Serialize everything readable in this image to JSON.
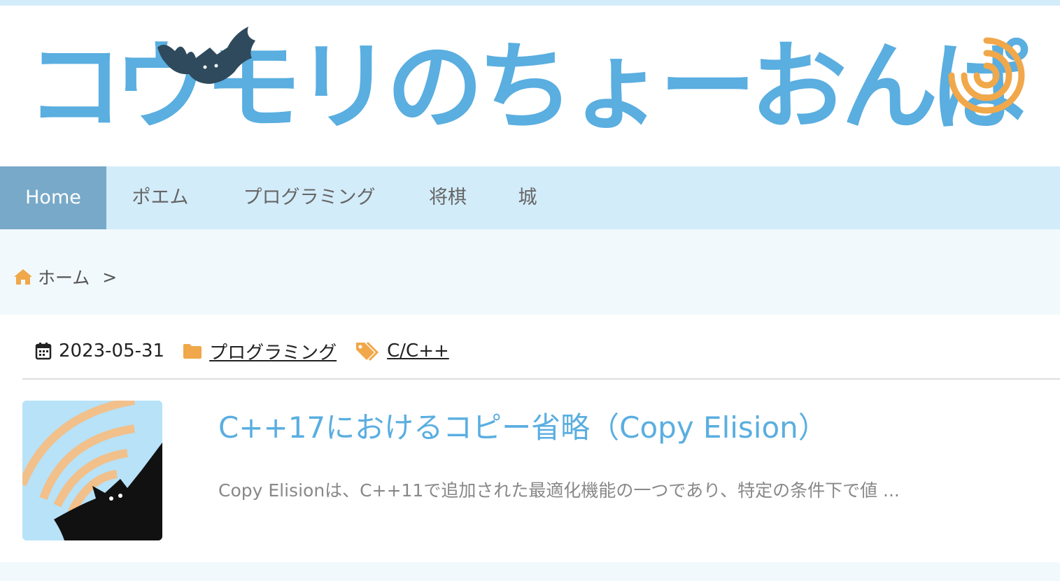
{
  "site": {
    "logo_text": "コウモリのちょーおんぱ",
    "logo_colors": {
      "text": "#5aaee0",
      "waves": "#f0a84a",
      "bat": "#2e4a5c"
    }
  },
  "nav": {
    "items": [
      {
        "label": "Home",
        "active": true
      },
      {
        "label": "ポエム"
      },
      {
        "label": "プログラミング"
      },
      {
        "label": "将棋"
      },
      {
        "label": "城"
      }
    ]
  },
  "breadcrumb": {
    "home_icon": "home-icon",
    "home_label": "ホーム",
    "separator": ">"
  },
  "post": {
    "date_icon": "calendar-icon",
    "date": "2023-05-31",
    "category_icon": "folder-icon",
    "category": "プログラミング",
    "tag_icon": "tag-icon",
    "tag": "C/C++",
    "title": "C++17におけるコピー省略（Copy Elision）",
    "excerpt": "Copy Elisionは、C++11で追加された最適化機能の一つであり、特定の条件下で値 ..."
  },
  "colors": {
    "accent_blue": "#5aaee0",
    "nav_bg": "#d3ecfa",
    "nav_active": "#78a9c8",
    "icon_orange": "#f0a84a"
  }
}
